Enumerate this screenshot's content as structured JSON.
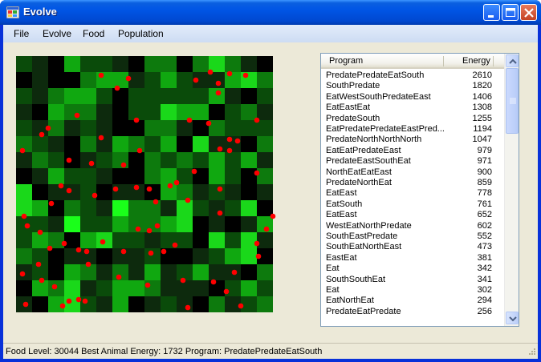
{
  "window": {
    "title": "Evolve"
  },
  "menu": [
    {
      "label": "File"
    },
    {
      "label": "Evolve"
    },
    {
      "label": "Food"
    },
    {
      "label": "Population"
    }
  ],
  "grid": {
    "cols": 16,
    "rows": 16,
    "colors": {
      "level0": "#000000",
      "level1": "#0d2a0d",
      "level2": "#0a4b0a",
      "level3": "#0d7a0d",
      "level4": "#10a810",
      "level5": "#1ad81a",
      "level6": "#1aff1a"
    },
    "cells": [
      "2104221033035310",
      "0100344124211453",
      "2134420222224102",
      "1043310225440231",
      "2131210033103222",
      "3210314324051103",
      "1320123032324241",
      "0142210034204203",
      "5011201104312101",
      "5403216331521250",
      "2216224334501014",
      "2430452212205251",
      "3201101120012450",
      "1204313141241103",
      "0435124431110242",
      "1045214012103123"
    ],
    "animal_color": "#ff0000",
    "animals": [
      [
        5.3,
        1.2
      ],
      [
        7.0,
        1.4
      ],
      [
        12.1,
        1.0
      ],
      [
        13.3,
        1.1
      ],
      [
        14.3,
        1.2
      ],
      [
        11.2,
        1.5
      ],
      [
        12.6,
        1.7
      ],
      [
        6.3,
        2.0
      ],
      [
        12.6,
        2.3
      ],
      [
        3.8,
        3.7
      ],
      [
        7.5,
        4.0
      ],
      [
        10.8,
        4.0
      ],
      [
        12.0,
        4.2
      ],
      [
        15.0,
        4.0
      ],
      [
        2.0,
        4.5
      ],
      [
        1.6,
        4.9
      ],
      [
        5.3,
        5.1
      ],
      [
        13.3,
        5.2
      ],
      [
        0.4,
        5.9
      ],
      [
        7.7,
        5.9
      ],
      [
        12.7,
        5.8
      ],
      [
        13.3,
        5.9
      ],
      [
        13.8,
        5.3
      ],
      [
        3.3,
        6.5
      ],
      [
        4.7,
        6.7
      ],
      [
        6.7,
        6.8
      ],
      [
        11.1,
        7.2
      ],
      [
        15.0,
        7.3
      ],
      [
        10.0,
        7.9
      ],
      [
        9.6,
        8.1
      ],
      [
        12.7,
        8.3
      ],
      [
        2.8,
        8.1
      ],
      [
        3.3,
        8.4
      ],
      [
        6.2,
        8.3
      ],
      [
        7.5,
        8.2
      ],
      [
        8.3,
        8.3
      ],
      [
        4.9,
        8.7
      ],
      [
        2.2,
        9.2
      ],
      [
        8.7,
        9.1
      ],
      [
        10.7,
        9.0
      ],
      [
        12.7,
        9.8
      ],
      [
        0.5,
        10.0
      ],
      [
        16.0,
        10.0
      ],
      [
        0.7,
        10.6
      ],
      [
        7.6,
        10.8
      ],
      [
        8.3,
        10.9
      ],
      [
        8.8,
        10.6
      ],
      [
        15.6,
        10.8
      ],
      [
        1.5,
        11.0
      ],
      [
        3.0,
        11.7
      ],
      [
        5.4,
        11.6
      ],
      [
        15.0,
        11.7
      ],
      [
        2.1,
        12.0
      ],
      [
        3.9,
        12.1
      ],
      [
        4.4,
        12.2
      ],
      [
        6.7,
        12.2
      ],
      [
        8.4,
        12.3
      ],
      [
        9.2,
        12.2
      ],
      [
        9.9,
        11.8
      ],
      [
        15.1,
        12.5
      ],
      [
        1.4,
        13.0
      ],
      [
        4.5,
        13.0
      ],
      [
        0.4,
        13.6
      ],
      [
        6.4,
        13.8
      ],
      [
        13.6,
        13.5
      ],
      [
        1.6,
        14.0
      ],
      [
        10.4,
        14.0
      ],
      [
        8.2,
        14.3
      ],
      [
        12.3,
        14.1
      ],
      [
        2.4,
        14.4
      ],
      [
        13.1,
        14.7
      ],
      [
        3.3,
        15.3
      ],
      [
        3.9,
        15.2
      ],
      [
        4.3,
        15.3
      ],
      [
        0.6,
        15.5
      ],
      [
        2.9,
        15.6
      ],
      [
        10.7,
        15.7
      ],
      [
        14.0,
        15.6
      ]
    ]
  },
  "program_list": {
    "columns": {
      "program": "Program",
      "energy": "Energy"
    },
    "rows": [
      {
        "program": "PredatePredateEatSouth",
        "energy": "2610"
      },
      {
        "program": "SouthPredate",
        "energy": "1820"
      },
      {
        "program": "EatWestSouthPredateEast",
        "energy": "1406"
      },
      {
        "program": "EatEastEat",
        "energy": "1308"
      },
      {
        "program": "PredateSouth",
        "energy": "1255"
      },
      {
        "program": "EatPredatePredateEastPred...",
        "energy": "1194"
      },
      {
        "program": "PredateNorthNorthNorth",
        "energy": "1047"
      },
      {
        "program": "EatEatPredateEast",
        "energy": "979"
      },
      {
        "program": "PredateEastSouthEat",
        "energy": "971"
      },
      {
        "program": "NorthEatEatEast",
        "energy": "900"
      },
      {
        "program": "PredateNorthEat",
        "energy": "859"
      },
      {
        "program": "EatEast",
        "energy": "778"
      },
      {
        "program": "EatSouth",
        "energy": "761"
      },
      {
        "program": "EatEast",
        "energy": "652"
      },
      {
        "program": "WestEatNorthPredate",
        "energy": "602"
      },
      {
        "program": "SouthEastPredate",
        "energy": "552"
      },
      {
        "program": "SouthEatNorthEast",
        "energy": "473"
      },
      {
        "program": "EastEat",
        "energy": "381"
      },
      {
        "program": "Eat",
        "energy": "342"
      },
      {
        "program": "SouthSouthEat",
        "energy": "341"
      },
      {
        "program": "Eat",
        "energy": "302"
      },
      {
        "program": "EatNorthEat",
        "energy": "294"
      },
      {
        "program": "PredateEatPredate",
        "energy": "256"
      }
    ]
  },
  "status": {
    "text": "Food Level: 30044 Best Animal Energy: 1732 Program: PredatePredateEatSouth"
  }
}
